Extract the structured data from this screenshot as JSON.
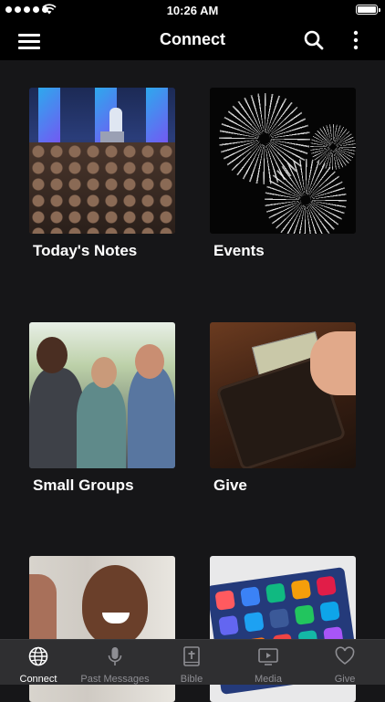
{
  "status_bar": {
    "time": "10:26 AM"
  },
  "header": {
    "title": "Connect"
  },
  "tiles": [
    {
      "label": "Today's Notes"
    },
    {
      "label": "Events"
    },
    {
      "label": "Small Groups"
    },
    {
      "label": "Give"
    }
  ],
  "tabs": [
    {
      "label": "Connect",
      "icon": "globe-icon",
      "active": true
    },
    {
      "label": "Past Messages",
      "icon": "microphone-icon"
    },
    {
      "label": "Bible",
      "icon": "bible-icon"
    },
    {
      "label": "Media",
      "icon": "play-screen-icon"
    },
    {
      "label": "Give",
      "icon": "heart-icon"
    }
  ],
  "colors": {
    "background": "#161618",
    "bar": "#000000",
    "tabbar": "#2f2f31",
    "inactive_tab": "#8e8e93"
  }
}
